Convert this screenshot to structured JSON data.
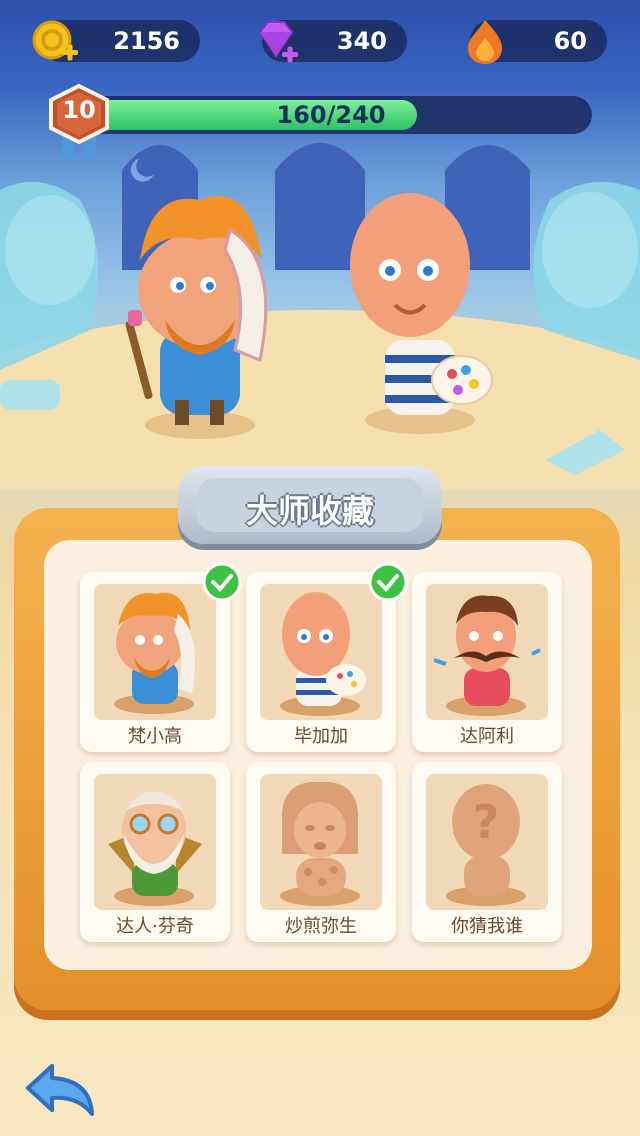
{
  "currencies": {
    "coins": {
      "value": "2156",
      "icon": "coin-plus-icon",
      "color": "#f5c21b"
    },
    "gems": {
      "value": "340",
      "icon": "gem-plus-icon",
      "color": "#c15cf0"
    },
    "fire": {
      "value": "60",
      "icon": "flame-icon",
      "color": "#f07a24"
    }
  },
  "level": {
    "number": "10",
    "progress_text": "160/240",
    "current": 160,
    "max": 240
  },
  "panel": {
    "title": "大师收藏"
  },
  "collection": [
    {
      "name": "梵小高",
      "collected": true,
      "locked": false
    },
    {
      "name": "毕加加",
      "collected": true,
      "locked": false
    },
    {
      "name": "达阿利",
      "collected": false,
      "locked": false
    },
    {
      "name": "达人·芬奇",
      "collected": false,
      "locked": false
    },
    {
      "name": "炒煎弥生",
      "collected": false,
      "locked": true
    },
    {
      "name": "你猜我谁",
      "collected": false,
      "locked": true
    }
  ]
}
